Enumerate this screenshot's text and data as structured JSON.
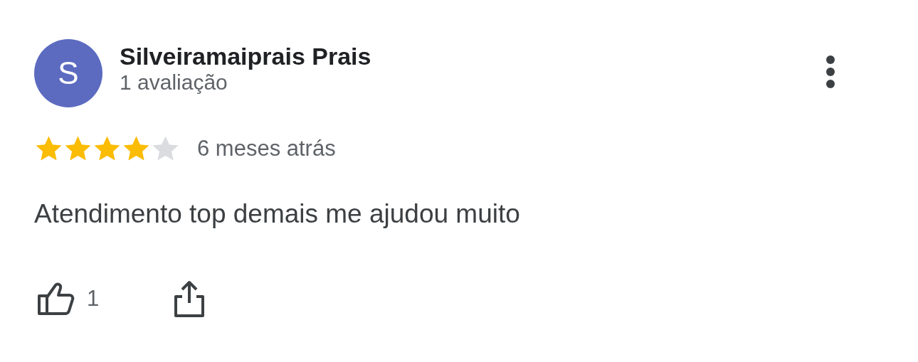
{
  "reviewer": {
    "initial": "S",
    "name": "Silveiramaiprais Prais",
    "review_count": "1 avaliação"
  },
  "rating": {
    "stars": 4,
    "time": "6 meses atrás"
  },
  "review_text": "Atendimento top demais me ajudou muito",
  "actions": {
    "likes": "1"
  }
}
